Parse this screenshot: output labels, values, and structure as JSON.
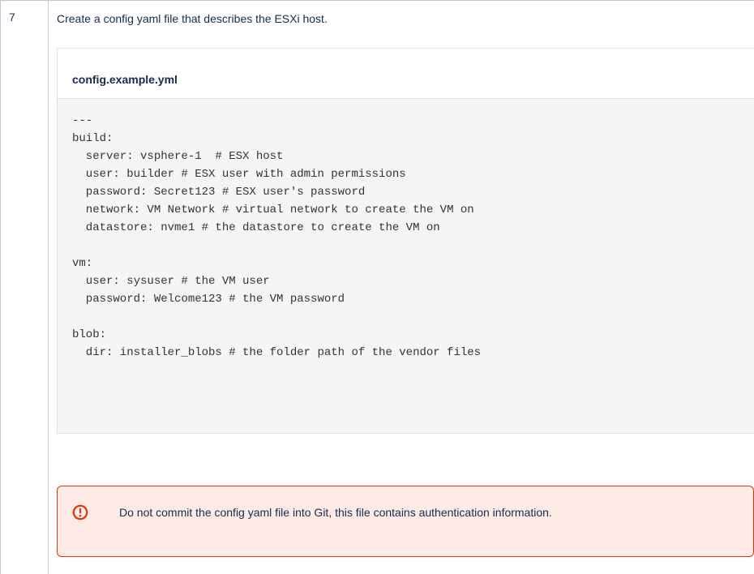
{
  "step": {
    "number": "7",
    "instruction": "Create a config yaml file that describes the ESXi host."
  },
  "code_block": {
    "filename": "config.example.yml",
    "lines": [
      "---",
      "build:",
      "  server: vsphere-1  # ESX host",
      "  user: builder # ESX user with admin permissions",
      "  password: Secret123 # ESX user's password",
      "  network: VM Network # virtual network to create the VM on",
      "  datastore: nvme1 # the datastore to create the VM on",
      "",
      "vm:",
      "  user: sysuser # the VM user",
      "  password: Welcome123 # the VM password",
      "",
      "blob:",
      "  dir: installer_blobs # the folder path of the vendor files"
    ]
  },
  "warning": {
    "icon": "warning-icon",
    "text": "Do not commit the config yaml file into Git, this file contains authentication information.",
    "color": "#de350b",
    "background": "#ffebe6"
  }
}
